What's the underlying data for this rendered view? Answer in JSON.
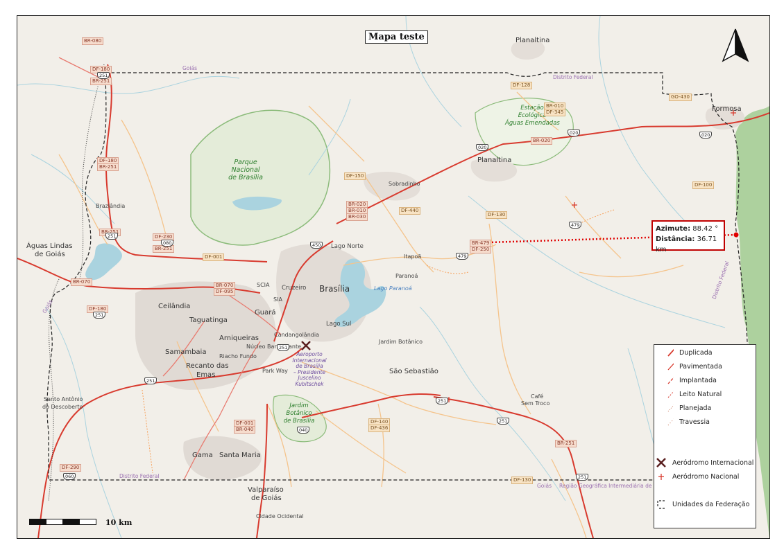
{
  "title": "Mapa teste",
  "scale": {
    "label": "10 km"
  },
  "measurement": {
    "azimuth_label": "Azimute:",
    "azimuth_value": "88.42 °",
    "distance_label": "Distância:",
    "distance_value": "36.71 km"
  },
  "legend": {
    "items": [
      {
        "label": "Duplicada"
      },
      {
        "label": "Pavimentada"
      },
      {
        "label": "Implantada"
      },
      {
        "label": "Leito Natural"
      },
      {
        "label": "Planejada"
      },
      {
        "label": "Travessia"
      }
    ],
    "airports": [
      {
        "label": "Aeródromo Internacional"
      },
      {
        "label": "Aeródromo Nacional"
      }
    ],
    "boundary": {
      "label": "Unidades da Federação"
    }
  },
  "places": {
    "brasilia": "Brasília",
    "planaltina_go": "Planaltina",
    "planaltina_df": "Planaltina",
    "formosa": "Formosa",
    "sobradinho": "Sobradinho",
    "lago_norte": "Lago Norte",
    "lago_sul": "Lago Sul",
    "paranoa": "Paranoá",
    "itapoa": "Itapoã",
    "cruzeiro": "Cruzeiro",
    "scia": "SCIA",
    "sia": "SIA",
    "guara": "Guará",
    "ceilandia": "Ceilândia",
    "taguatinga": "Taguatinga",
    "arniqueiras": "Arniqueiras",
    "candangolandia": "Candangolândia",
    "nucleo_bandeirante": "Núcleo Bandeirante",
    "riacho_fundo": "Riacho Fundo",
    "samambaia": "Samambaia",
    "recanto_line1": "Recanto das",
    "recanto_line2": "Emas",
    "park_way": "Park Way",
    "jardim_botanico": "Jardim Botânico",
    "sao_sebastiao": "São Sebastião",
    "aguas_lindas_line1": "Águas Lindas",
    "aguas_lindas_line2": "de Goiás",
    "brazlandia": "Brazlândia",
    "santo_antonio_line1": "Santo Antônio",
    "santo_antonio_line2": "do Descoberto",
    "gama": "Gama",
    "santa_maria": "Santa Maria",
    "valparaiso_line1": "Valparaíso",
    "valparaiso_line2": "de Goiás",
    "cidade_ocidental": "Cidade Ocidental",
    "cafe_sem_troco_line1": "Café",
    "cafe_sem_troco_line2": "Sem Troco",
    "lago_paranoa": "Lago Paranoá",
    "distrito_federal_north": "Distrito Federal",
    "distrito_federal_south": "Distrito Federal",
    "goias_west": "Goiás",
    "goias_north": "Goiás",
    "goias_south": "Goiás",
    "regiao_geografica": "Região Geográfica Intermediária de Luziânia",
    "distrito_federal_east": "Distrito Federal"
  },
  "parks": {
    "pnb_line1": "Parque",
    "pnb_line2": "Nacional",
    "pnb_line3": "de Brasília",
    "eeae_line1": "Estação",
    "eeae_line2": "Ecológica",
    "eeae_line3": "Águas Emendadas",
    "jbb_line1": "Jardim",
    "jbb_line2": "Botânico",
    "jbb_line3": "de Brasília",
    "airport_line1": "Aeroporto",
    "airport_line2": "Internacional",
    "airport_line3": "de Brasília",
    "airport_line4": "– Presidente",
    "airport_line5": "Juscelino",
    "airport_line6": "Kubitschek"
  },
  "road_labels": {
    "br080": "BR-080",
    "df180_nw": "DF-180",
    "br251_nw": "BR-251",
    "df128": "DF-128",
    "br010": "BR-010",
    "df345": "DF-345",
    "go430": "GO-430",
    "br020_ne": "BR-020",
    "df180_w": "DF-180",
    "br251_w": "BR-251",
    "df150": "DF-150",
    "br020": "BR-020",
    "br010_c": "BR-010",
    "br030": "BR-030",
    "df440": "DF-440",
    "df130": "DF-130",
    "br479": "BR-479",
    "df250": "DF-250",
    "df100": "DF-100",
    "df230": "DF-230",
    "br251_c": "BR-251",
    "br070": "BR-070",
    "df001_w": "DF-001",
    "br070_c": "BR-070",
    "df095": "DF-095",
    "df180_sw": "DF-180",
    "df001_s": "DF-001",
    "br040": "BR-040",
    "df140": "DF-140",
    "df436": "DF-436",
    "df290": "DF-290",
    "df130_s": "DF-130",
    "br251_se": "BR-251",
    "br251_a": "BR-251"
  },
  "shields": [
    "251",
    "251",
    "080",
    "450",
    "479",
    "479",
    "251",
    "251",
    "251",
    "040",
    "251",
    "251",
    "060",
    "020",
    "020",
    "020",
    "251"
  ]
}
